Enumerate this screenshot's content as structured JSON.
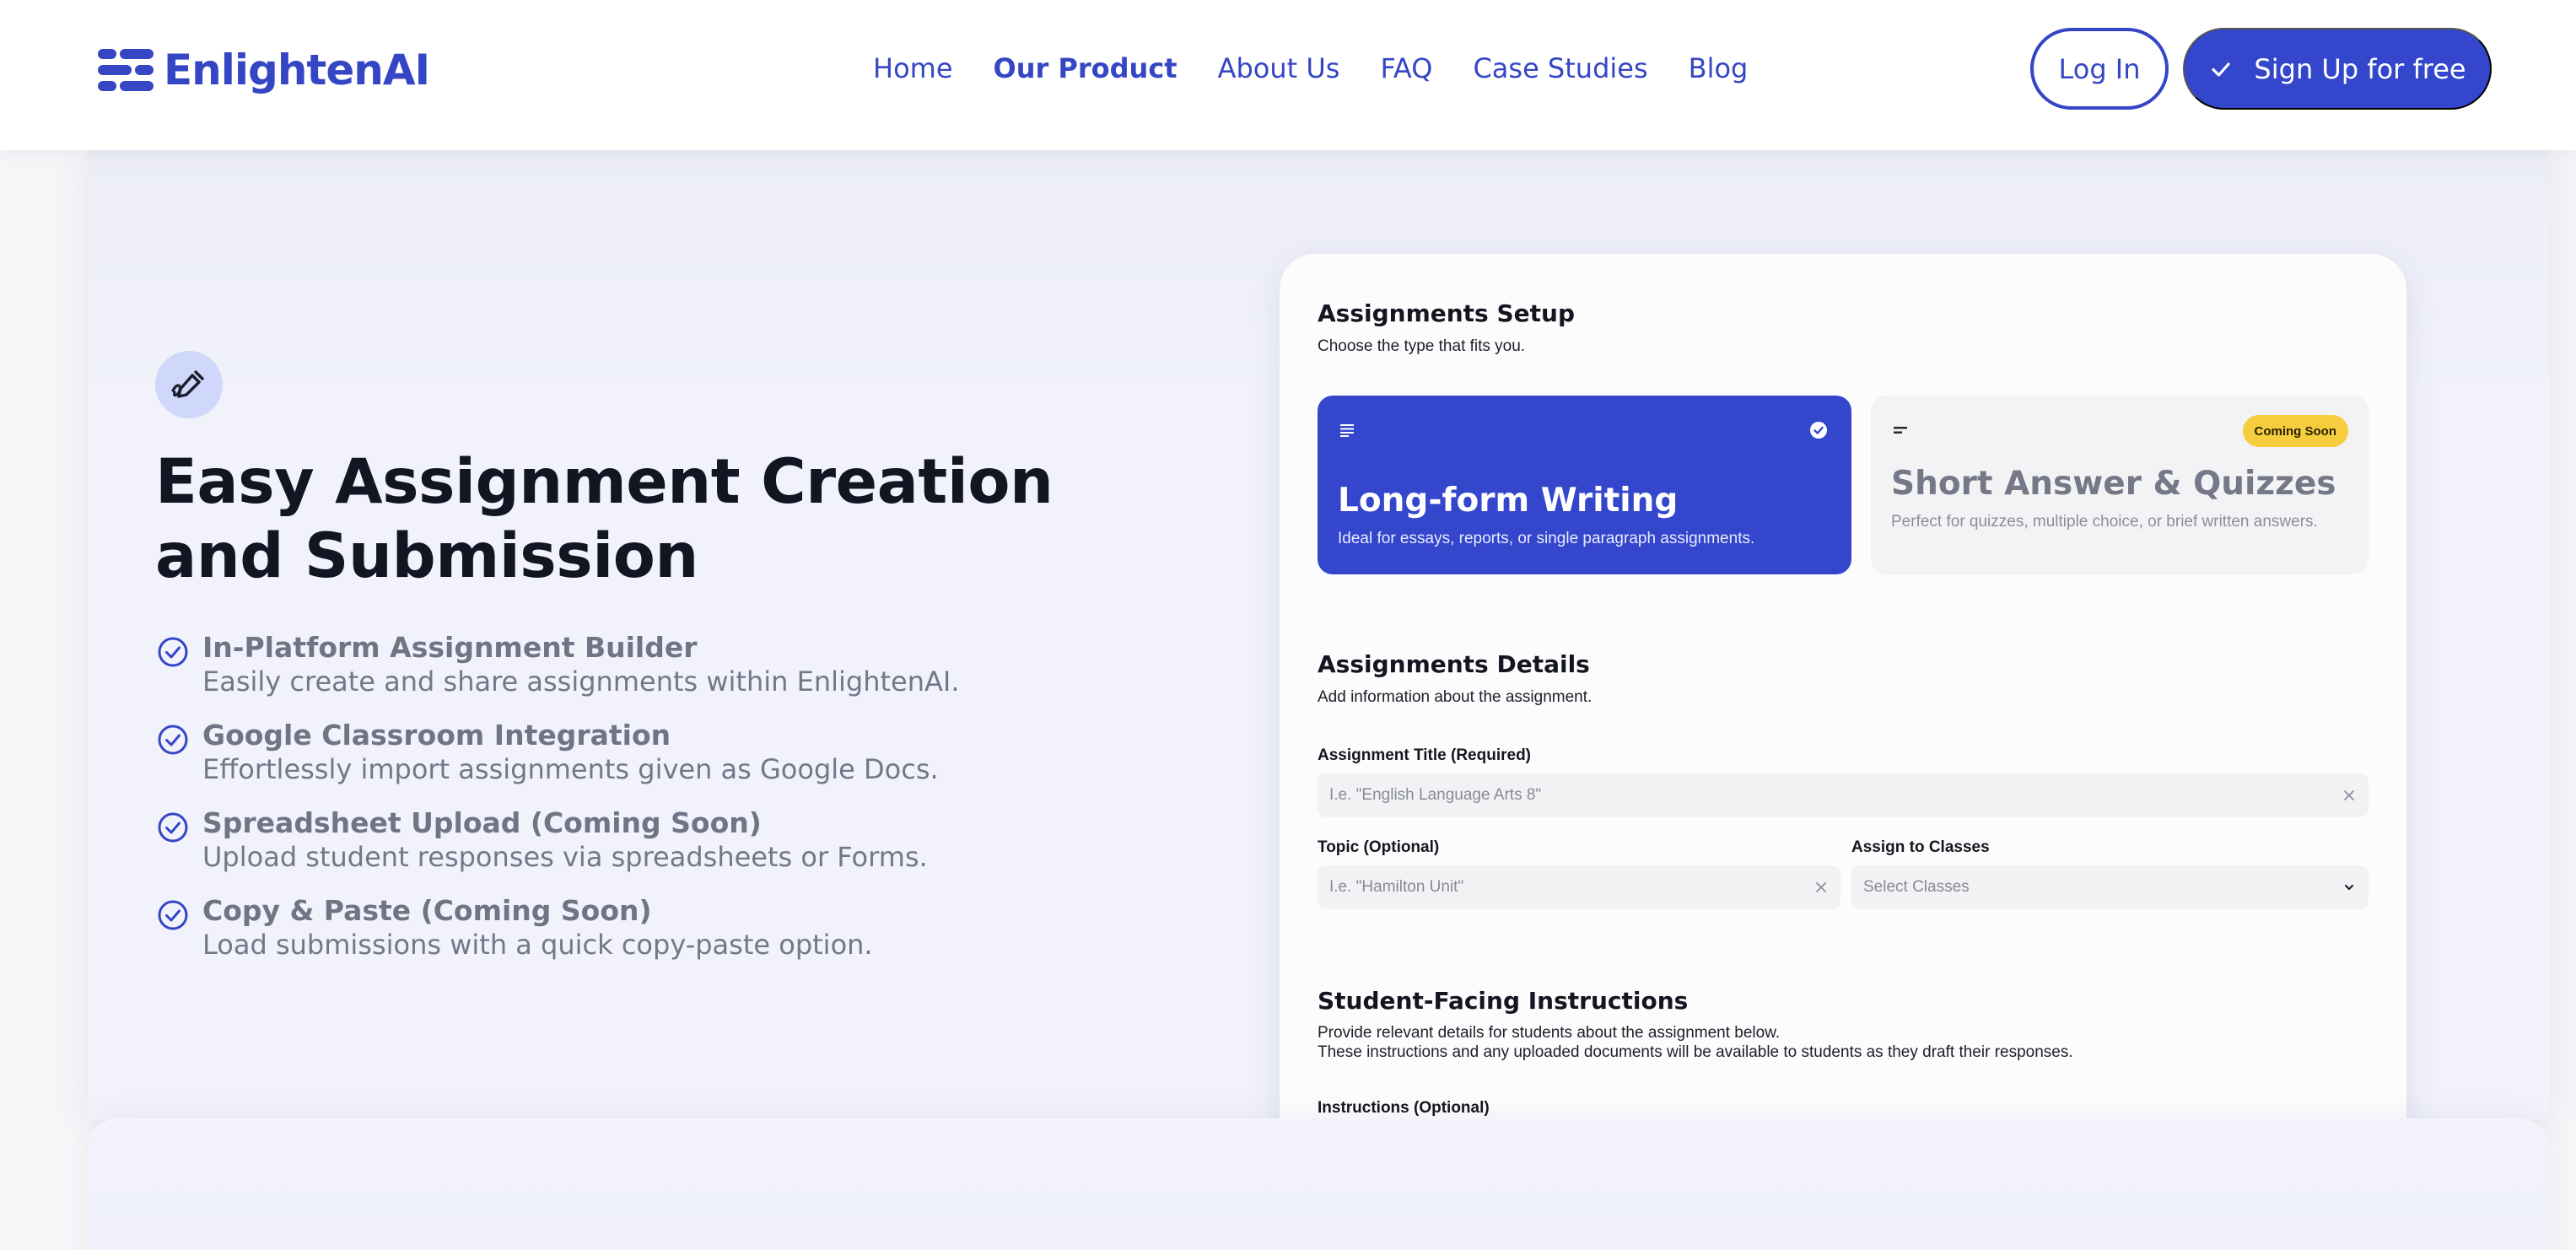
{
  "brand": {
    "name": "EnlightenAI",
    "color": "#3546c4"
  },
  "nav": {
    "items": [
      {
        "label": "Home"
      },
      {
        "label": "Our Product",
        "active": true
      },
      {
        "label": "About Us"
      },
      {
        "label": "FAQ"
      },
      {
        "label": "Case Studies"
      },
      {
        "label": "Blog"
      }
    ],
    "login_label": "Log In",
    "signup_label": "Sign Up for free"
  },
  "hero": {
    "icon": "pen-icon",
    "title": "Easy Assignment Creation and Submission",
    "features": [
      {
        "title": "In-Platform Assignment Builder",
        "desc": "Easily create and share assignments within EnlightenAI."
      },
      {
        "title": "Google Classroom Integration",
        "desc": "Effortlessly import assignments given as Google Docs."
      },
      {
        "title": "Spreadsheet Upload (Coming Soon)",
        "desc": "Upload student responses via spreadsheets or Forms."
      },
      {
        "title": "Copy & Paste (Coming Soon)",
        "desc": "Load submissions with a quick copy-paste option."
      }
    ]
  },
  "mockup": {
    "setup": {
      "title": "Assignments Setup",
      "subtitle": "Choose the type that fits you.",
      "types": [
        {
          "title": "Long-form Writing",
          "desc": "Ideal for essays, reports, or single paragraph assignments.",
          "selected": true
        },
        {
          "title": "Short Answer & Quizzes",
          "desc": "Perfect for quizzes, multiple choice, or brief written answers.",
          "badge": "Coming Soon"
        }
      ]
    },
    "details": {
      "title": "Assignments Details",
      "subtitle": "Add information about the assignment.",
      "assignment_title_label": "Assignment Title (Required)",
      "assignment_title_placeholder": "I.e. \"English Language Arts 8\"",
      "topic_label": "Topic (Optional)",
      "topic_placeholder": "I.e. \"Hamilton Unit\"",
      "classes_label": "Assign to Classes",
      "classes_value": "Select Classes"
    },
    "instructions": {
      "title": "Student-Facing Instructions",
      "subtitle_line1": "Provide relevant details for students about the assignment below.",
      "subtitle_line2": "These instructions and any uploaded documents will be available to students as they draft their responses.",
      "field_label": "Instructions (Optional)"
    }
  },
  "colors": {
    "accent": "#3346cc",
    "badge": "#f6cd3e",
    "panel": "#f1f2fb"
  }
}
